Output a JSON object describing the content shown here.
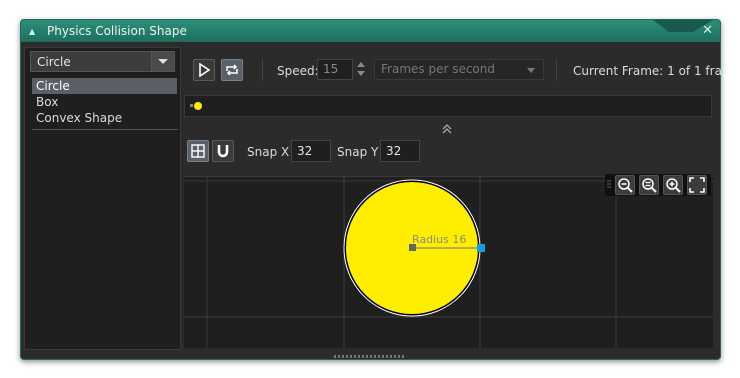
{
  "window": {
    "title": "Physics Collision Shape",
    "close_glyph": "✕"
  },
  "shape_dropdown": {
    "selected": "Circle",
    "options": [
      "Circle",
      "Box",
      "Convex Shape"
    ]
  },
  "playback": {
    "speed_label": "Speed:",
    "speed_value": "15",
    "speed_unit": "Frames per second",
    "current_frame_text": "Current Frame: 1 of 1 fra"
  },
  "snap": {
    "x_label": "Snap X",
    "x_value": "32",
    "y_label": "Snap Y",
    "y_value": "32"
  },
  "collision": {
    "radius_label": "Radius 16"
  },
  "icons": {
    "play": "play-icon",
    "loop": "loop-icon",
    "grid": "grid-icon",
    "magnet": "magnet-icon",
    "zoom_out": "zoom-out-icon",
    "zoom_reset": "zoom-reset-icon",
    "zoom_in": "zoom-in-icon",
    "fit": "fit-to-screen-icon",
    "collapse": "collapse-up-icon"
  },
  "colors": {
    "accent": "#1e6e5e",
    "shape_fill": "#ffee00",
    "handle": "#1a9bdc",
    "panel": "#2b2b2b"
  }
}
